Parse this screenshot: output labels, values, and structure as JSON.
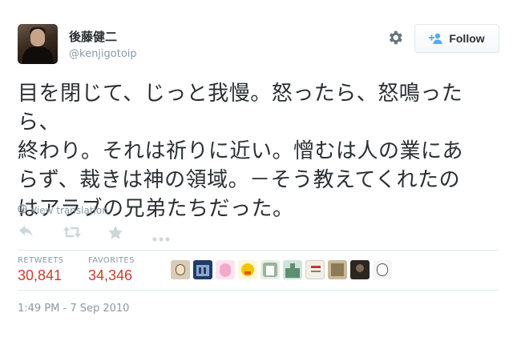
{
  "user": {
    "display_name": "後藤健二",
    "handle": "@kenjigotoip",
    "avatar_icon": "user-avatar-photo"
  },
  "header": {
    "settings_icon": "gear-icon",
    "follow_label": "Follow",
    "follow_icon": "add-user-icon"
  },
  "tweet": {
    "text": "目を閉じて、じっと我慢。怒ったら、怒鳴ったら、\n終わり。それは祈りに近い。憎むは人の業にあ\nらず、裁きは神の領域。－そう教えてくれたの\nはアラブの兄弟たちだった。"
  },
  "translation": {
    "label": "View translation",
    "icon": "globe-icon"
  },
  "actions": [
    {
      "name": "reply",
      "icon": "reply-icon"
    },
    {
      "name": "retweet",
      "icon": "retweet-icon"
    },
    {
      "name": "favorite",
      "icon": "star-icon"
    },
    {
      "name": "more",
      "icon": "more-dots-icon"
    }
  ],
  "stats": {
    "retweets_label": "RETWEETS",
    "retweets_value": "30,841",
    "favorites_label": "FAVORITES",
    "favorites_value": "34,346"
  },
  "favorited_by": [
    {
      "icon": "face-avatar"
    },
    {
      "icon": "building-avatar"
    },
    {
      "icon": "pink-character-avatar"
    },
    {
      "icon": "yellow-bird-avatar"
    },
    {
      "icon": "anime-avatar"
    },
    {
      "icon": "castle-avatar"
    },
    {
      "icon": "drawing-avatar"
    },
    {
      "icon": "box-avatar"
    },
    {
      "icon": "dark-avatar"
    },
    {
      "icon": "sketch-avatar"
    }
  ],
  "timestamp": "1:49 PM - 7 Sep 2010",
  "colors": {
    "text": "#292f33",
    "muted": "#8899a6",
    "accent": "#55acee",
    "count": "#cc3d2c",
    "border": "#e1e8ed"
  }
}
